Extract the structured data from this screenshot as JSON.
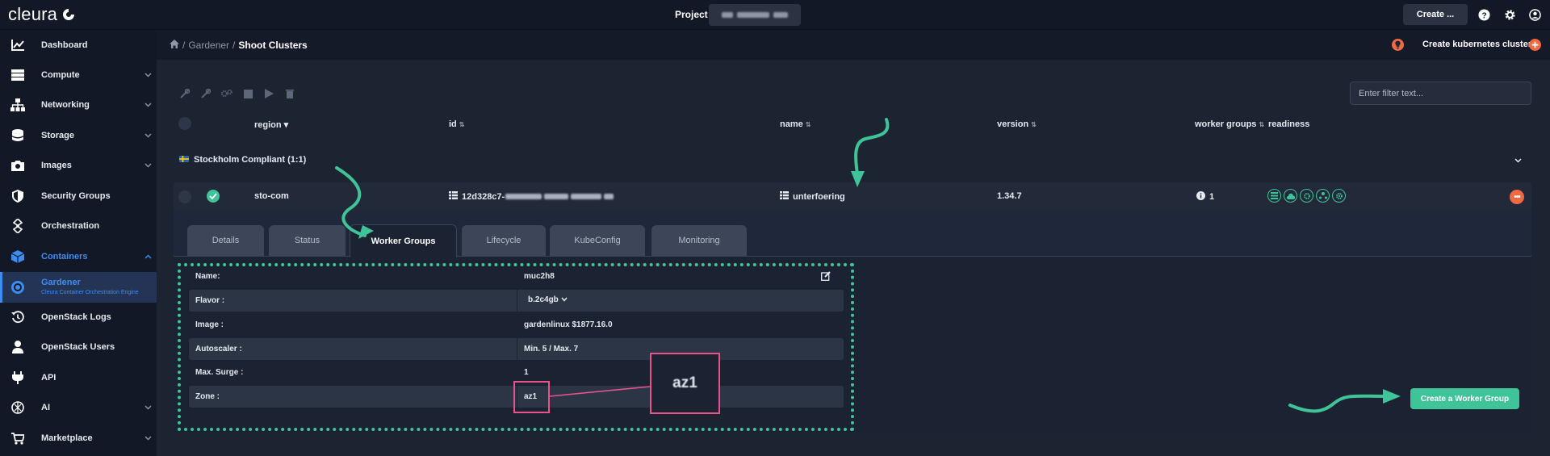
{
  "topbar": {
    "brand": "cleura",
    "project_label": "Project",
    "create_label": "Create ...",
    "icons": [
      "help-icon",
      "gear-icon",
      "user-icon"
    ]
  },
  "sidebar": {
    "items": [
      {
        "label": "Dashboard",
        "icon": "chart-icon"
      },
      {
        "label": "Compute",
        "icon": "server-icon"
      },
      {
        "label": "Networking",
        "icon": "network-icon"
      },
      {
        "label": "Storage",
        "icon": "database-icon"
      },
      {
        "label": "Images",
        "icon": "camera-icon"
      },
      {
        "label": "Security Groups",
        "icon": "shield-icon"
      },
      {
        "label": "Orchestration",
        "icon": "orchestration-icon"
      },
      {
        "label": "Containers",
        "icon": "cube-icon"
      },
      {
        "label": "Gardener",
        "sublabel": "Cleura Container Orchestration Engine",
        "icon": "gardener-icon"
      },
      {
        "label": "OpenStack Logs",
        "icon": "history-icon"
      },
      {
        "label": "OpenStack Users",
        "icon": "user-icon"
      },
      {
        "label": "API",
        "icon": "plug-icon"
      },
      {
        "label": "AI",
        "icon": "ai-icon"
      },
      {
        "label": "Marketplace",
        "icon": "cart-icon"
      }
    ]
  },
  "header": {
    "breadcrumb": [
      "Gardener",
      "Shoot Clusters"
    ],
    "create_cluster_label": "Create kubernetes cluster"
  },
  "filter": {
    "placeholder": "Enter filter text..."
  },
  "table": {
    "columns": [
      "region",
      "id",
      "name",
      "version",
      "worker groups",
      "readiness"
    ],
    "group_label": "Stockholm Compliant (1:1)",
    "row": {
      "region": "sto-com",
      "id_prefix": "12d328c7-",
      "name": "unterfoering",
      "version": "1.34.7",
      "worker_groups": "1"
    }
  },
  "tabs": [
    "Details",
    "Status",
    "Worker Groups",
    "Lifecycle",
    "KubeConfig",
    "Monitoring"
  ],
  "active_tab": "Worker Groups",
  "worker_group": {
    "rows": [
      {
        "label": "Name:",
        "value": "muc2h8"
      },
      {
        "label": "Flavor :",
        "value": "b.2c4gb"
      },
      {
        "label": "Image :",
        "value": "gardenlinux $1877.16.0"
      },
      {
        "label": "Autoscaler :",
        "value": "Min. 5 / Max. 7"
      },
      {
        "label": "Max. Surge :",
        "value": "1"
      },
      {
        "label": "Zone :",
        "value": "az1"
      }
    ]
  },
  "create_worker_group_label": "Create a Worker Group",
  "annotation": {
    "zoom_text": "az1"
  },
  "colors": {
    "accent_green": "#3fc49a",
    "accent_blue": "#3d8cf2",
    "accent_orange": "#ef6a43",
    "annotation_pink": "#e8538c"
  }
}
